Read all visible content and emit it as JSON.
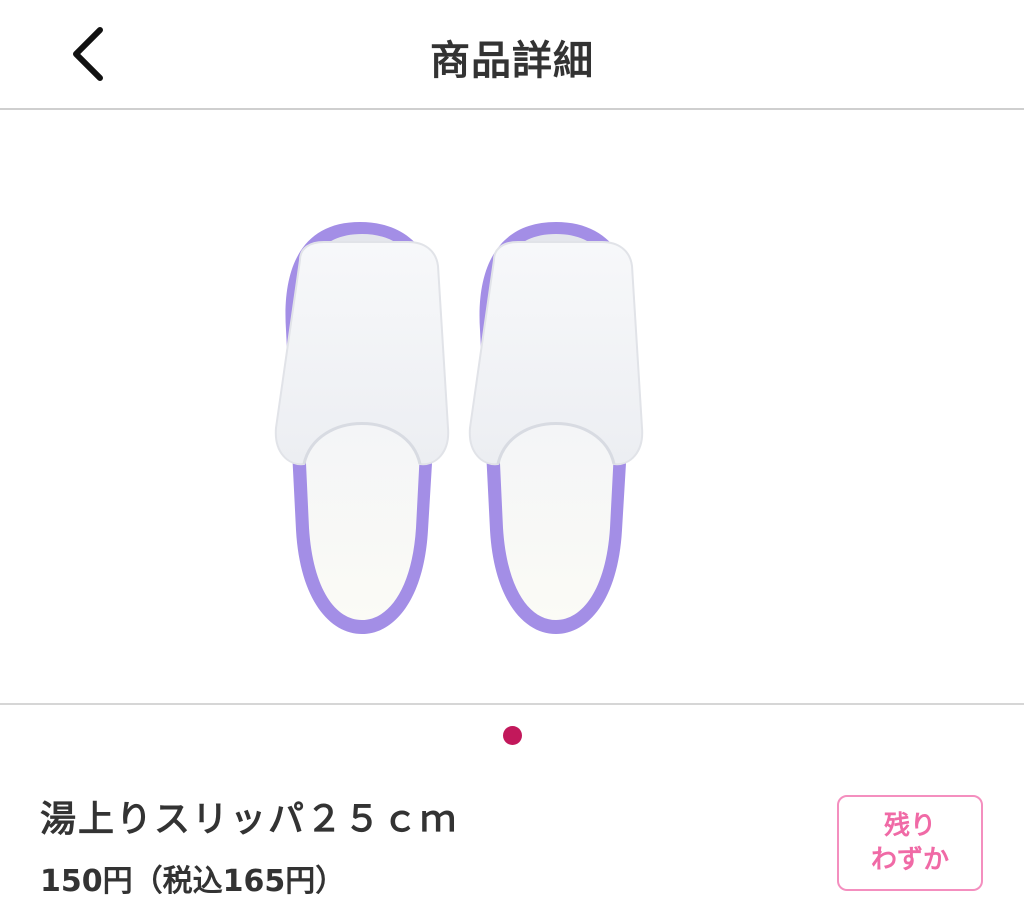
{
  "header": {
    "title": "商品詳細",
    "back_icon": "chevron-left-icon"
  },
  "carousel": {
    "image_alt": "slippers-product-photo",
    "page_count": 1,
    "current_page": 1,
    "active_dot_color": "#c2185b"
  },
  "product": {
    "name": "湯上りスリッパ２５ｃｍ",
    "price": "150円（税込165円）",
    "stock_badge_line1": "残り",
    "stock_badge_line2": "わずか",
    "badge_color": "#f06aa6"
  },
  "colors": {
    "slipper_trim": "#a38ee6",
    "slipper_body": "#f2f3f6"
  }
}
